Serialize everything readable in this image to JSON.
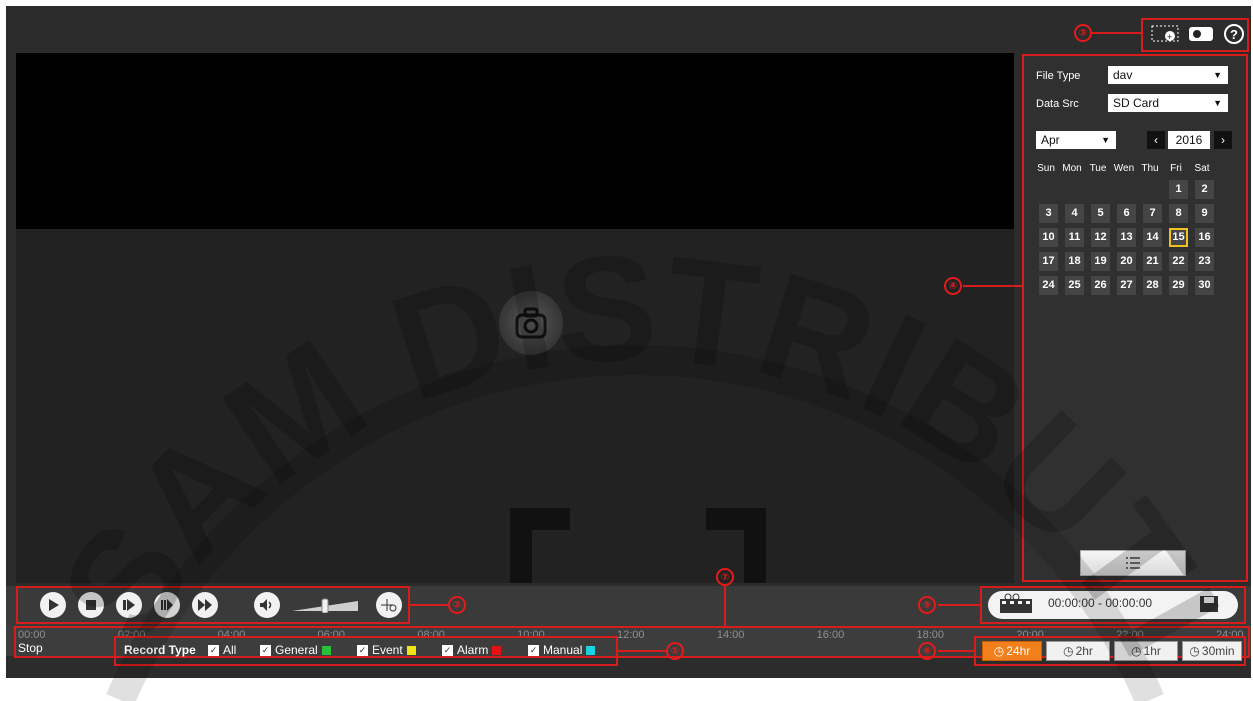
{
  "sidebar": {
    "file_type_label": "File Type",
    "file_type_value": "dav",
    "data_src_label": "Data Src",
    "data_src_value": "SD Card",
    "month": "Apr",
    "year": "2016",
    "weekdays": [
      "Sun",
      "Mon",
      "Tue",
      "Wen",
      "Thu",
      "Fri",
      "Sat"
    ],
    "days": [
      "1",
      "2",
      "3",
      "4",
      "5",
      "6",
      "7",
      "8",
      "9",
      "10",
      "11",
      "12",
      "13",
      "14",
      "15",
      "16",
      "17",
      "18",
      "19",
      "20",
      "21",
      "22",
      "23",
      "24",
      "25",
      "26",
      "27",
      "28",
      "29",
      "30"
    ],
    "selected_day": "15"
  },
  "clip": {
    "time_range": "00:00:00 - 00:00:00"
  },
  "timeline": {
    "ticks": [
      "00:00",
      "02:00",
      "04:00",
      "06:00",
      "08:00",
      "10:00",
      "12:00",
      "14:00",
      "16:00",
      "18:00",
      "20:00",
      "22:00",
      "24:00"
    ]
  },
  "status": {
    "stop": "Stop"
  },
  "record_type": {
    "label": "Record Type",
    "items": [
      {
        "label": "All",
        "color": ""
      },
      {
        "label": "General",
        "color": "#27c23a"
      },
      {
        "label": "Event",
        "color": "#f2e316"
      },
      {
        "label": "Alarm",
        "color": "#e81010"
      },
      {
        "label": "Manual",
        "color": "#1ad3e0"
      }
    ]
  },
  "time_scale": {
    "buttons": [
      "24hr",
      "2hr",
      "1hr",
      "30min"
    ],
    "active": "24hr"
  },
  "callouts": [
    "①",
    "②",
    "③",
    "④",
    "⑤",
    "⑥",
    "⑦"
  ],
  "watermark": "SAM DISTRIBUTION",
  "icons": [
    "zoom-icon",
    "record-icon",
    "help-icon",
    "play-icon",
    "stop-icon",
    "step-back-icon",
    "slow-icon",
    "fast-icon",
    "volume-icon",
    "fisheye-icon",
    "clip-icon",
    "save-icon",
    "list-icon",
    "clock-icon",
    "camera-icon"
  ]
}
